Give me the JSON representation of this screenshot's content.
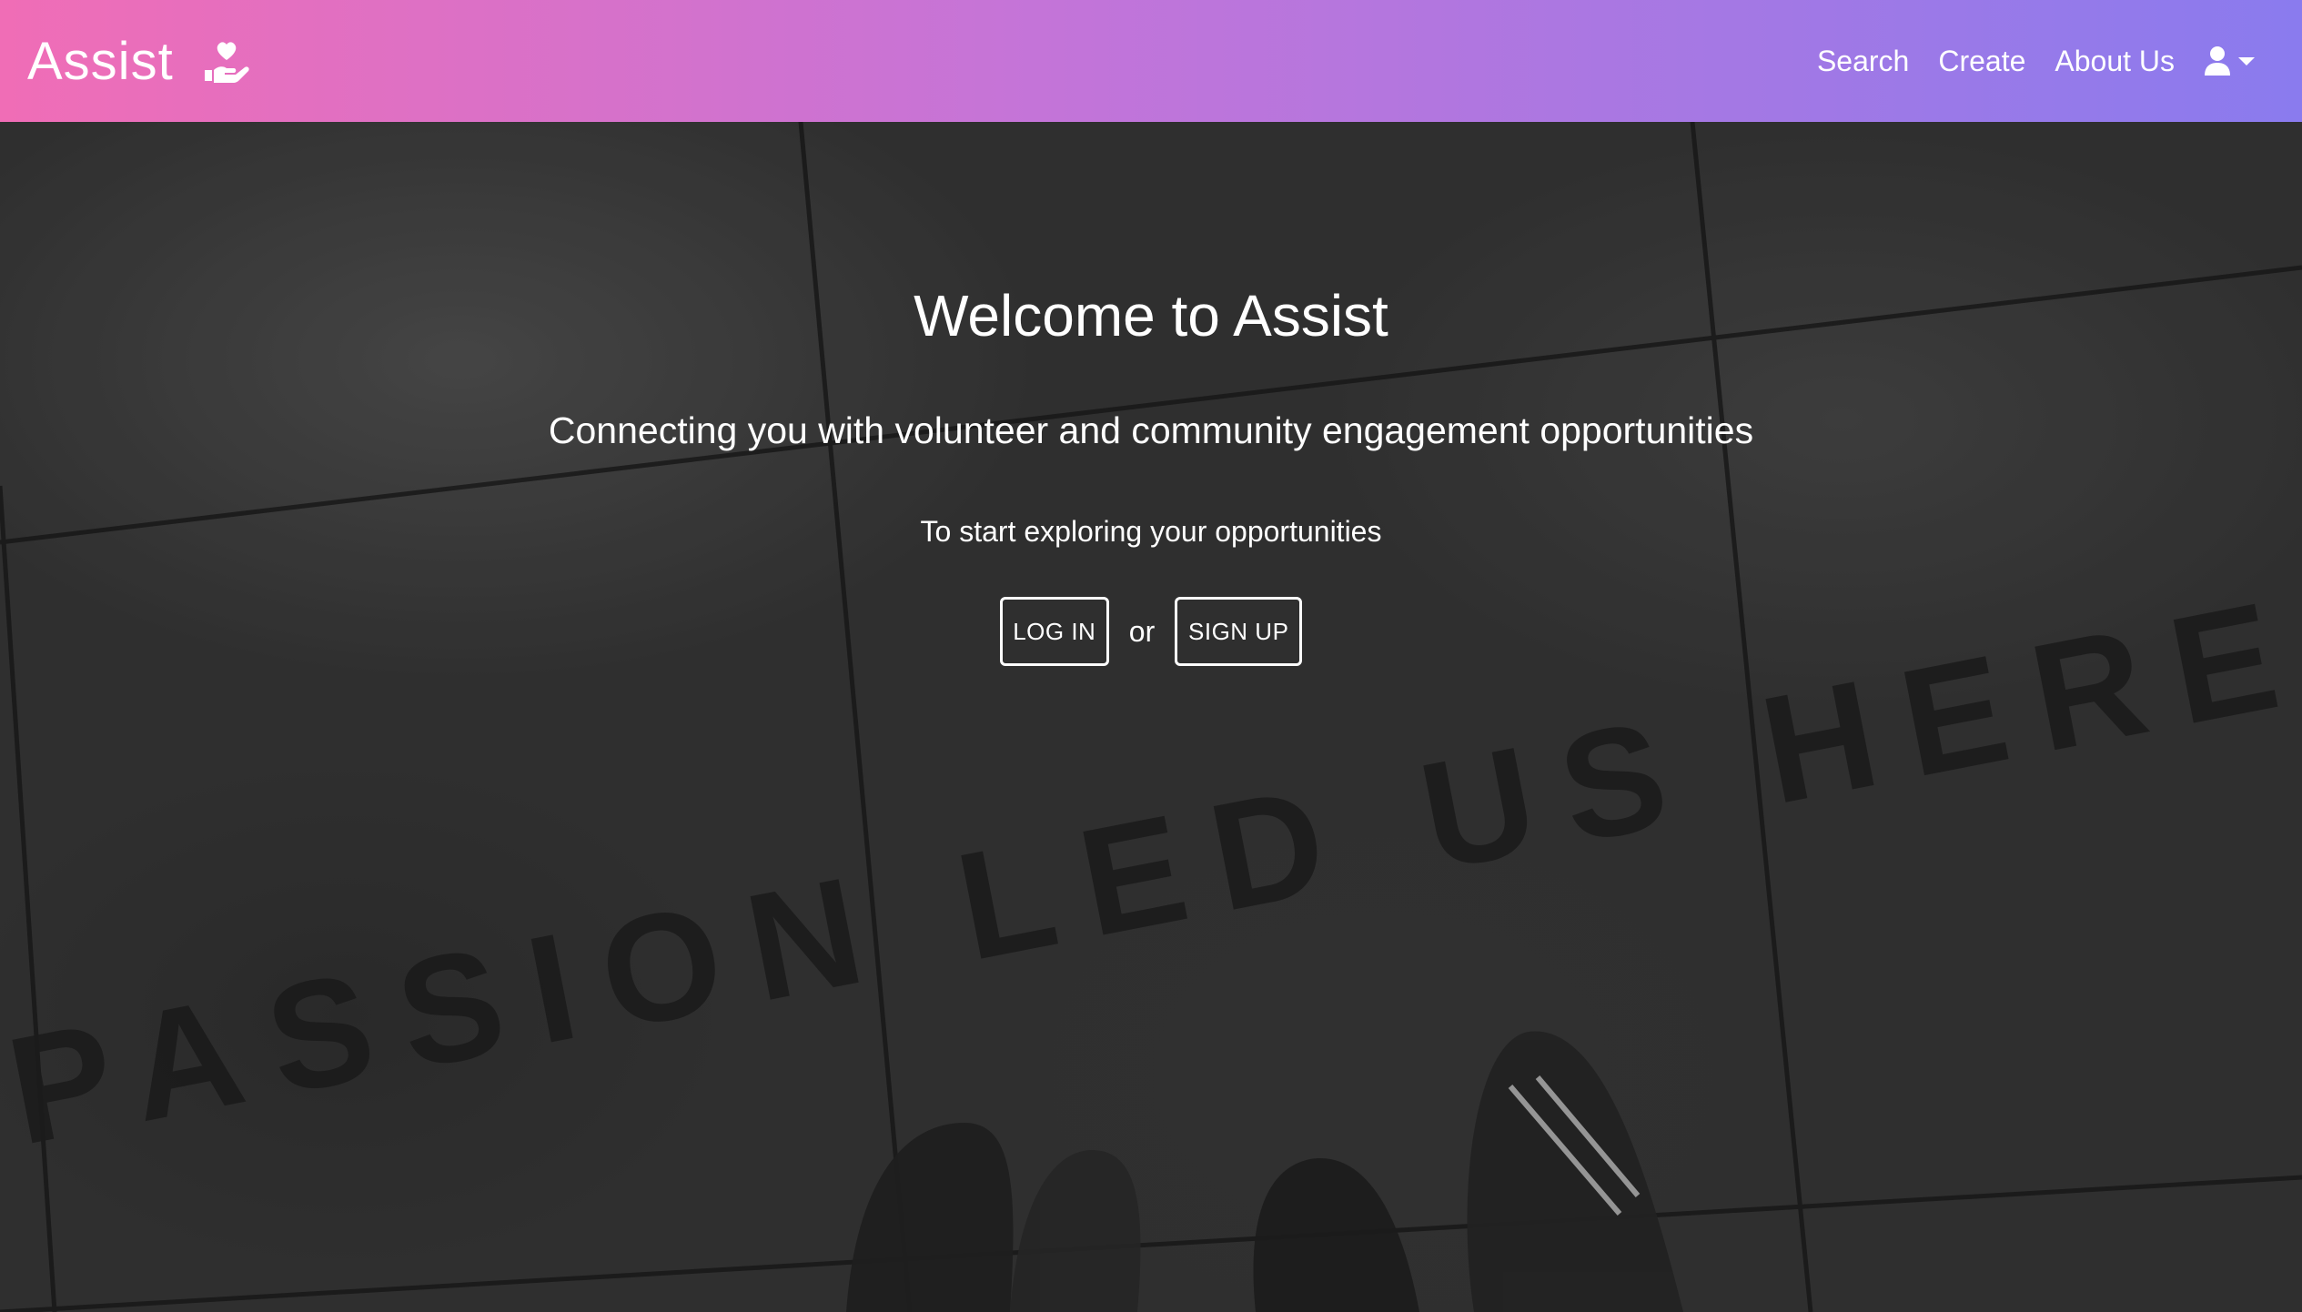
{
  "app": {
    "brand": "Assist",
    "brand_icon": "hand-holding-heart-icon"
  },
  "nav": {
    "links": [
      {
        "label": "Search"
      },
      {
        "label": "Create"
      },
      {
        "label": "About Us"
      }
    ],
    "user_icon": "user-icon",
    "dropdown_icon": "caret-down-icon"
  },
  "hero": {
    "title": "Welcome to Assist",
    "subtitle": "Connecting you with volunteer and community engagement opportunities",
    "prompt": "To start exploring your opportunities",
    "login_label": "LOG IN",
    "or_label": "or",
    "signup_label": "SIGN UP",
    "background_text": "PASSION LED US HERE"
  },
  "colors": {
    "gradient_start": "#f06db6",
    "gradient_end": "#8a7bee",
    "text": "#ffffff"
  }
}
